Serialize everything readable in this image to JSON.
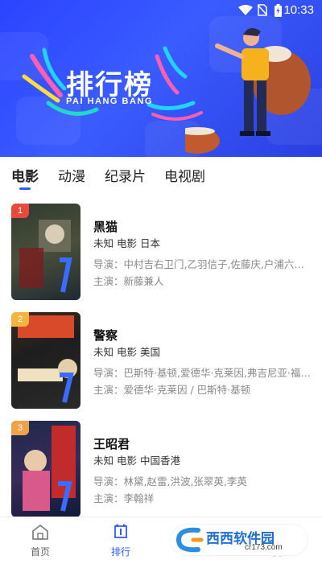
{
  "status": {
    "time": "10:33",
    "icons": [
      "wifi-icon",
      "no-sim-icon",
      "battery-icon"
    ]
  },
  "banner": {
    "title": "排行榜",
    "subtitle": "PAI HANG BANG"
  },
  "tabs": [
    {
      "label": "电影",
      "active": true
    },
    {
      "label": "动漫"
    },
    {
      "label": "纪录片"
    },
    {
      "label": "电视剧"
    }
  ],
  "items": [
    {
      "rank": "1",
      "title": "黑猫",
      "meta": "未知  电影  日本",
      "director": "导演：中村吉右卫门,乙羽信子,佐藤庆,户浦六宏,...",
      "actor": "主演：新藤兼人"
    },
    {
      "rank": "2",
      "title": "警察",
      "meta": "未知  电影  美国",
      "director": "导演：巴斯特·基顿,爱德华·克莱因,弗吉尼亚·福克斯",
      "actor": "主演：爱德华·克莱因 / 巴斯特·基顿"
    },
    {
      "rank": "3",
      "title": "王昭君",
      "meta": "未知  电影  中国香港",
      "director": "导演：林黛,赵雷,洪波,张翠英,李英",
      "actor": "主演：李翰祥"
    }
  ],
  "bottom_nav": [
    {
      "label": "首页",
      "icon": "home-icon"
    },
    {
      "label": "排行",
      "icon": "ranking-icon",
      "active": true
    },
    {
      "label": "找片",
      "icon": "search-icon"
    },
    {
      "label": "我的",
      "icon": "profile-icon"
    }
  ],
  "watermark": {
    "text": "西西软件园",
    "url": "cr173.com"
  },
  "colors": {
    "accent": "#2e5bff",
    "banner_blue": "#3151ff",
    "rank1": "#e64a3c",
    "rank2": "#f2b640",
    "rank3": "#f0a24a"
  }
}
